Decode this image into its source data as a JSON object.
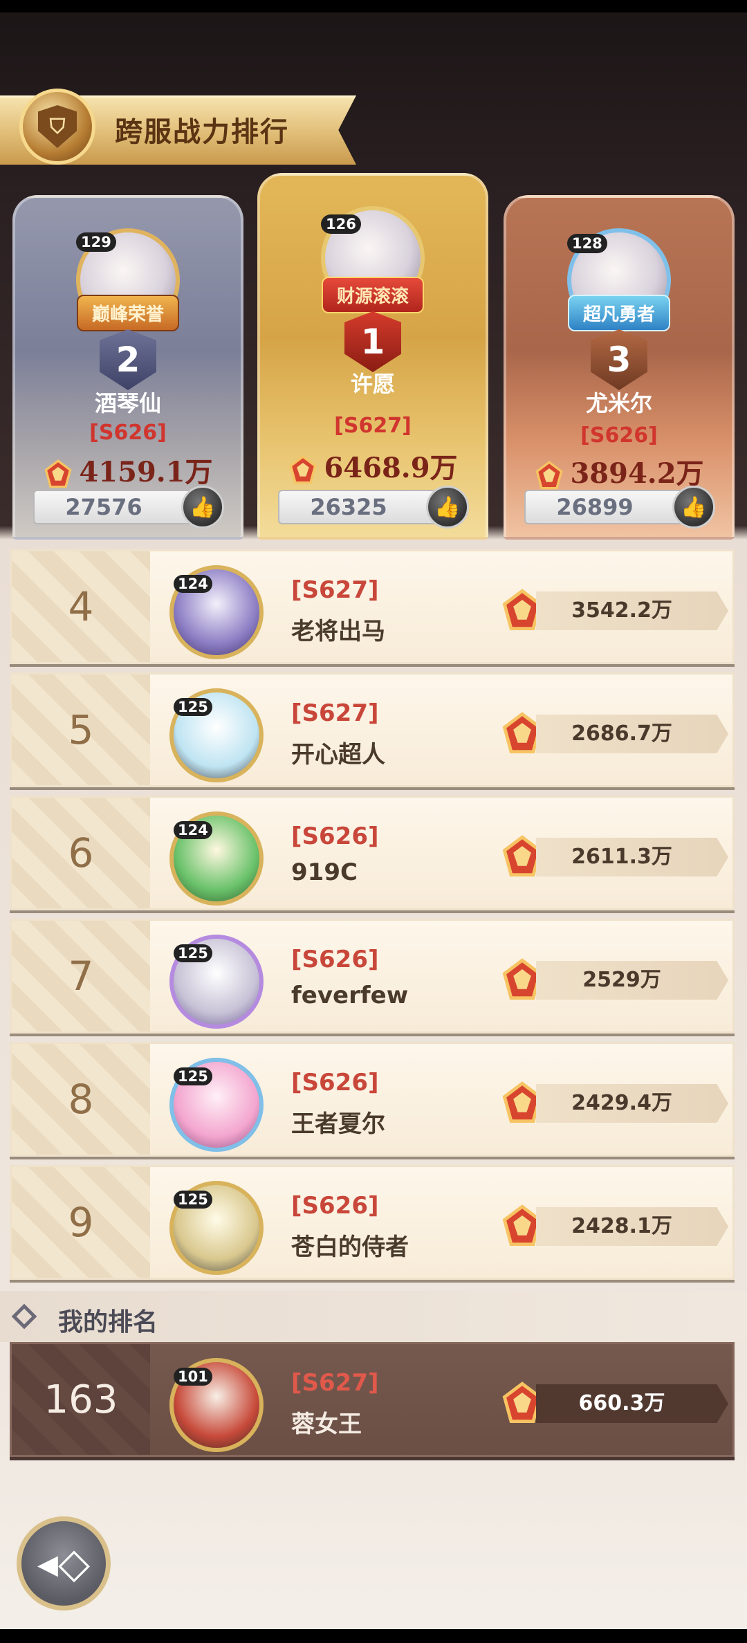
{
  "header": {
    "title": "跨服战力排行",
    "emblem_icon": "leaderboard-shield-icon"
  },
  "podium": [
    {
      "rank": "2",
      "level": "129",
      "title": "巅峰荣誉",
      "name": "酒琴仙",
      "server": "[S626]",
      "power": "4159.1万",
      "likes": "27576"
    },
    {
      "rank": "1",
      "level": "126",
      "title": "财源滚滚",
      "name": "许愿",
      "server": "[S627]",
      "power": "6468.9万",
      "likes": "26325"
    },
    {
      "rank": "3",
      "level": "128",
      "title": "超凡勇者",
      "name": "尤米尔",
      "server": "[S626]",
      "power": "3894.2万",
      "likes": "26899"
    }
  ],
  "rows": [
    {
      "rank": "4",
      "level": "124",
      "server": "[S627]",
      "name": "老将出马",
      "power": "3542.2万"
    },
    {
      "rank": "5",
      "level": "125",
      "server": "[S627]",
      "name": "开心超人",
      "power": "2686.7万"
    },
    {
      "rank": "6",
      "level": "124",
      "server": "[S626]",
      "name": "919C",
      "power": "2611.3万"
    },
    {
      "rank": "7",
      "level": "125",
      "server": "[S626]",
      "name": "feverfew",
      "power": "2529万"
    },
    {
      "rank": "8",
      "level": "125",
      "server": "[S626]",
      "name": "王者夏尔",
      "power": "2429.4万"
    },
    {
      "rank": "9",
      "level": "125",
      "server": "[S626]",
      "name": "苍白的侍者",
      "power": "2428.1万"
    }
  ],
  "my_rank": {
    "label": "我的排名",
    "rank": "163",
    "level": "101",
    "server": "[S627]",
    "name": "蓉女王",
    "power": "660.3万"
  },
  "colors": {
    "gold": "#e2c07a",
    "silver": "#8c8fa6",
    "bronze": "#d8895e",
    "server_red": "#c8473a"
  }
}
